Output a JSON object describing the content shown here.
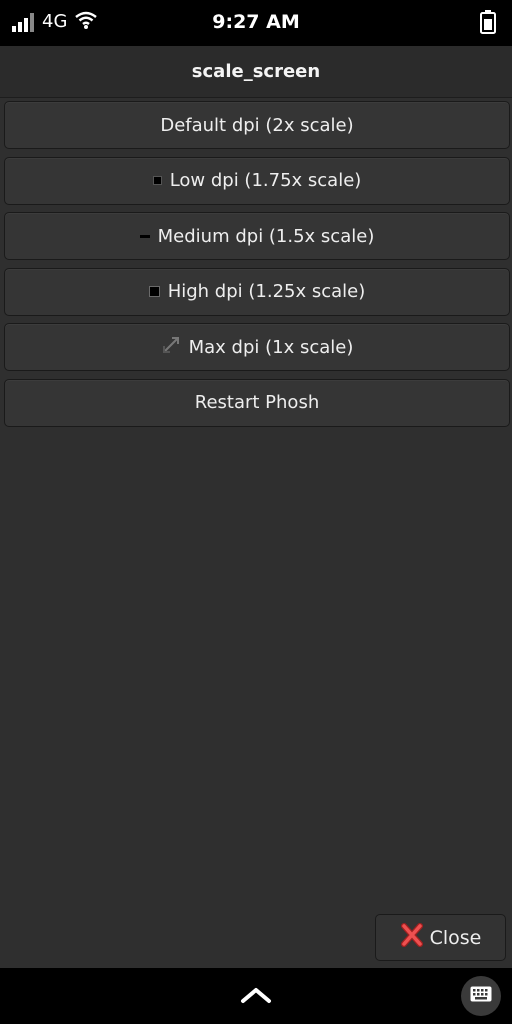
{
  "status_bar": {
    "network": "4G",
    "time": "9:27 AM",
    "icons": [
      "signal-icon",
      "wifi-icon",
      "battery-icon"
    ]
  },
  "header": {
    "title": "scale_screen"
  },
  "options": [
    {
      "label": "Default dpi (2x scale)",
      "icon": null
    },
    {
      "label": "Low dpi (1.75x scale)",
      "icon": "small-square-icon"
    },
    {
      "label": "Medium dpi (1.5x scale)",
      "icon": "dash-icon"
    },
    {
      "label": "High dpi (1.25x scale)",
      "icon": "square-icon"
    },
    {
      "label": "Max dpi (1x scale)",
      "icon": "expand-icon"
    },
    {
      "label": "Restart Phosh",
      "icon": null
    }
  ],
  "close_button": {
    "label": "Close",
    "icon": "red-x-icon"
  },
  "bottom_bar": {
    "icons": [
      "chevron-up-icon",
      "keyboard-icon"
    ]
  },
  "colors": {
    "background": "#2f2f2f",
    "button": "#353535",
    "close_icon": "#e04040"
  }
}
